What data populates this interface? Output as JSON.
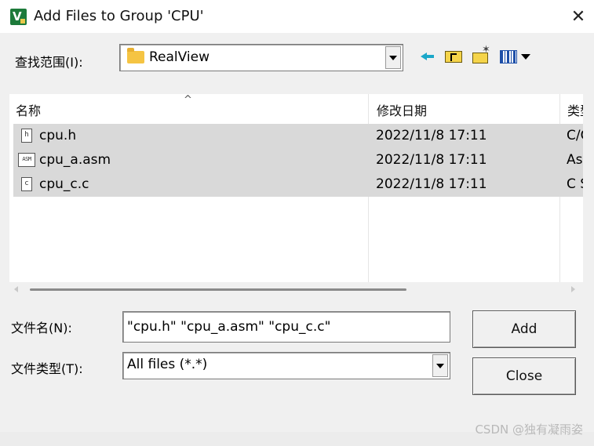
{
  "window": {
    "title": "Add Files to Group 'CPU'",
    "close_glyph": "✕"
  },
  "look_in": {
    "label": "查找范围(I):",
    "value": "RealView"
  },
  "toolbar": {
    "icons": [
      "back-arrow-icon",
      "up-folder-icon",
      "new-folder-icon",
      "view-menu-icon"
    ]
  },
  "file_list": {
    "columns": [
      "名称",
      "修改日期",
      "类型"
    ],
    "sort_indicator": "^",
    "rows": [
      {
        "name": "cpu.h",
        "date": "2022/11/8 17:11",
        "type": "C/C",
        "icon": "h-file-icon",
        "icon_text": "h"
      },
      {
        "name": "cpu_a.asm",
        "date": "2022/11/8 17:11",
        "type": "As",
        "icon": "asm-file-icon",
        "icon_text": "ASM"
      },
      {
        "name": "cpu_c.c",
        "date": "2022/11/8 17:11",
        "type": "C S",
        "icon": "c-file-icon",
        "icon_text": "c"
      }
    ]
  },
  "file_name": {
    "label": "文件名(N):",
    "value": "\"cpu.h\" \"cpu_a.asm\" \"cpu_c.c\""
  },
  "file_type": {
    "label": "文件类型(T):",
    "value": "All files (*.*)"
  },
  "buttons": {
    "add": "Add",
    "close": "Close"
  },
  "watermark": "CSDN @独有凝雨姿",
  "colors": {
    "selected_row": "#d9d9d9",
    "dialog_bg": "#f0f0f0",
    "app_icon": "#1d7a3a"
  }
}
